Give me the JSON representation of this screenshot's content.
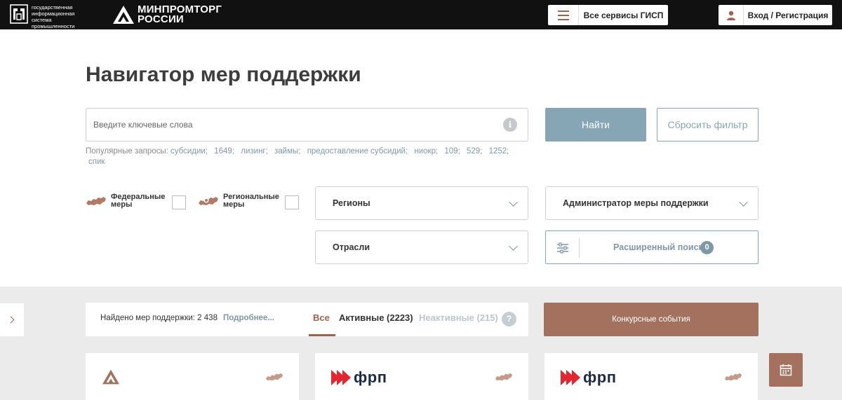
{
  "header": {
    "gisp_text": "государственная информационная система промышленности",
    "ministry_line1": "МИНПРОМТОРГ",
    "ministry_line2": "РОССИИ",
    "services_label": "Все сервисы ГИСП",
    "login_label": "Вход / Регистрация"
  },
  "page": {
    "title": "Навигатор мер поддержки"
  },
  "search": {
    "placeholder": "Введите ключевые слова",
    "value": "",
    "find_label": "Найти",
    "reset_label": "Сбросить фильтр",
    "popular_label": "Популярные запросы:",
    "popular_queries": [
      "субсидии;",
      "1649;",
      "лизинг;",
      "займы;",
      "предоставление субсидий;",
      "ниокр;",
      "109;",
      "529;",
      "1252;",
      "спик"
    ]
  },
  "filters": {
    "federal_line1": "Федеральные",
    "federal_line2": "меры",
    "regional_line1": "Региональные",
    "regional_line2": "меры",
    "regions_label": "Регионы",
    "administrator_label": "Администратор меры поддержки",
    "industries_label": "Отрасли",
    "advanced_label": "Расширенный поиск",
    "advanced_count": "0"
  },
  "results": {
    "found_label": "Найдено мер поддержки: 2 438",
    "more_label": "Подробнее...",
    "tab_all": "Все",
    "tab_active": "Активные (2223)",
    "tab_inactive": "Неактивные (215)",
    "help": "?",
    "contest_label": "Конкурсные события"
  },
  "cards": [
    {
      "logo": "minpromtorg-logo"
    },
    {
      "logo": "frp-logo",
      "logo_text": "фрп"
    },
    {
      "logo": "frp-logo",
      "logo_text": "фрп"
    }
  ],
  "colors": {
    "header_bg": "#111111",
    "accent_brown": "#a4715f",
    "accent_blue": "#86a6b5",
    "gray_bg": "#ebebeb",
    "frp_red": "#e3262f"
  }
}
